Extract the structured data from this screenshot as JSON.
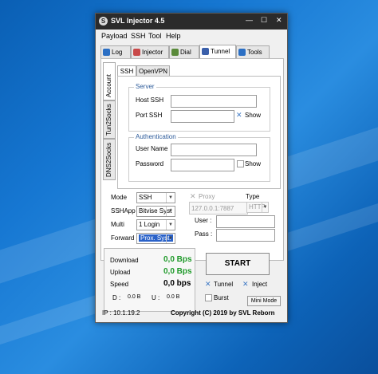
{
  "window": {
    "title": "SVL Injector 4.5",
    "app_icon_glyph": "S",
    "minimize": "—",
    "maximize": "☐",
    "close": "✕"
  },
  "menu": [
    "Payload",
    "SSH",
    "Tool",
    "Help"
  ],
  "tabs": [
    {
      "label": "Log",
      "icon": "log-icon",
      "color": "#2b6fc4"
    },
    {
      "label": "Injector",
      "icon": "syringe-icon",
      "color": "#c94a4a"
    },
    {
      "label": "Dial",
      "icon": "phone-icon",
      "color": "#5a8a3a"
    },
    {
      "label": "Tunnel",
      "icon": "tunnel-icon",
      "color": "#3a5faa"
    },
    {
      "label": "Tools",
      "icon": "tools-icon",
      "color": "#2b6fc4"
    }
  ],
  "side_tabs": [
    "Account",
    "Tun2Socks",
    "DNS2Socks"
  ],
  "sub_tabs": [
    "SSH",
    "OpenVPN"
  ],
  "server": {
    "legend": "Server",
    "host_label": "Host SSH",
    "host_value": "",
    "port_label": "Port SSH",
    "port_value": "",
    "show_label": "Show"
  },
  "auth": {
    "legend": "Authentication",
    "user_label": "User Name",
    "user_value": "",
    "pass_label": "Password",
    "pass_value": "",
    "show_label": "Show"
  },
  "settings": {
    "mode_label": "Mode",
    "mode_value": "SSH",
    "sshapp_label": "SSHApp",
    "sshapp_value": "Bitvise Syst",
    "multi_label": "Multi",
    "multi_value": "1 Login",
    "forward_label": "Forward",
    "forward_value": "Prox. Syst.",
    "proxy_label": "Proxy",
    "proxy_value": "127.0.0.1:7887",
    "type_label": "Type",
    "type_value": "HTTP",
    "user_label": "User :",
    "pass_label": "Pass :"
  },
  "stats": {
    "download_label": "Download",
    "download_value": "0,0 Bps",
    "upload_label": "Upload",
    "upload_value": "0,0 Bps",
    "speed_label": "Speed",
    "speed_value": "0,0 bps",
    "d_label": "D :",
    "d_value": "0.0 B",
    "u_label": "U :",
    "u_value": "0.0 B",
    "value_color": "#1f9a2a"
  },
  "controls": {
    "start_label": "START",
    "tunnel_label": "Tunnel",
    "inject_label": "Inject",
    "burst_label": "Burst",
    "mini_label": "Mini Mode"
  },
  "status": {
    "ip_text": "IP : 10.1.19.2",
    "copyright": "Copyright (C) 2019 by SVL Reborn"
  }
}
